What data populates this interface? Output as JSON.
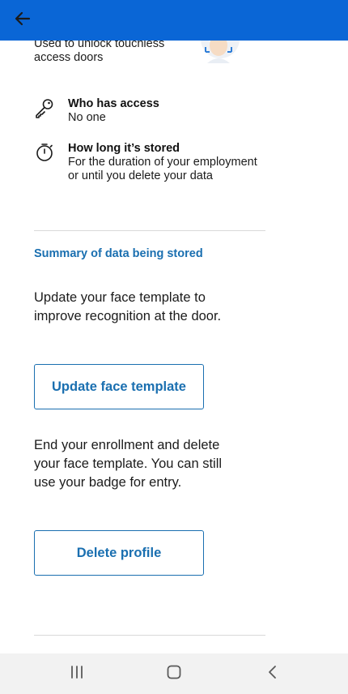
{
  "header": {
    "background": "#0a66d6",
    "back_icon": "arrow-left-icon"
  },
  "purpose": {
    "text": "Used to unlock touchless access doors",
    "illustration": "face-scan-illustration"
  },
  "access": {
    "icon": "key-icon",
    "title": "Who has access",
    "value": "No one"
  },
  "storage": {
    "icon": "stopwatch-icon",
    "title": "How long it’s stored",
    "value": "For the duration of your employment or until you delete your data"
  },
  "summary_link": "Summary of data being stored",
  "update_section": {
    "description": "Update your face template to improve recognition at the door.",
    "button_label": "Update face template"
  },
  "delete_section": {
    "description": "End your enrollment and delete your face template. You can still use your badge for entry.",
    "button_label": "Delete profile"
  },
  "nav": {
    "recents_icon": "recent-apps-icon",
    "home_icon": "home-icon",
    "back_icon": "chevron-left-icon"
  },
  "colors": {
    "accent": "#1a6fb0",
    "header": "#0a66d6",
    "divider": "#d9d9d9",
    "nav_background": "#f2f2f2"
  }
}
